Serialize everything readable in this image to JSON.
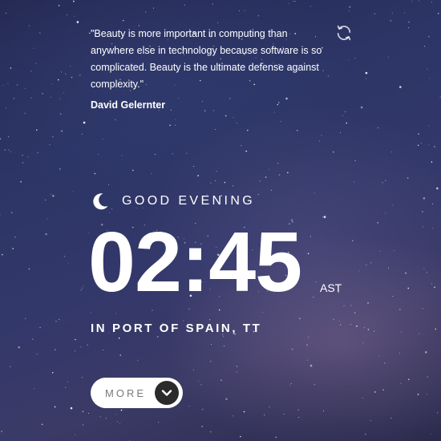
{
  "quote": {
    "text": "\"Beauty is more important in computing than anywhere else in technology because software is so complicated. Beauty is the ultimate defense against complexity.\"",
    "author": "David Gelernter"
  },
  "greeting": {
    "text": "GOOD EVENING",
    "icon": "moon-icon"
  },
  "clock": {
    "time": "02:45",
    "timezone": "AST"
  },
  "location": {
    "text": "IN PORT OF SPAIN, TT"
  },
  "more_button": {
    "label": "MORE",
    "icon": "chevron-down-icon"
  },
  "controls": {
    "refresh_icon": "refresh-icon"
  },
  "colors": {
    "text": "#ffffff",
    "button_bg": "#ffffff",
    "button_text": "#7a7a7a",
    "chevron_bg": "#2b2b2b"
  }
}
